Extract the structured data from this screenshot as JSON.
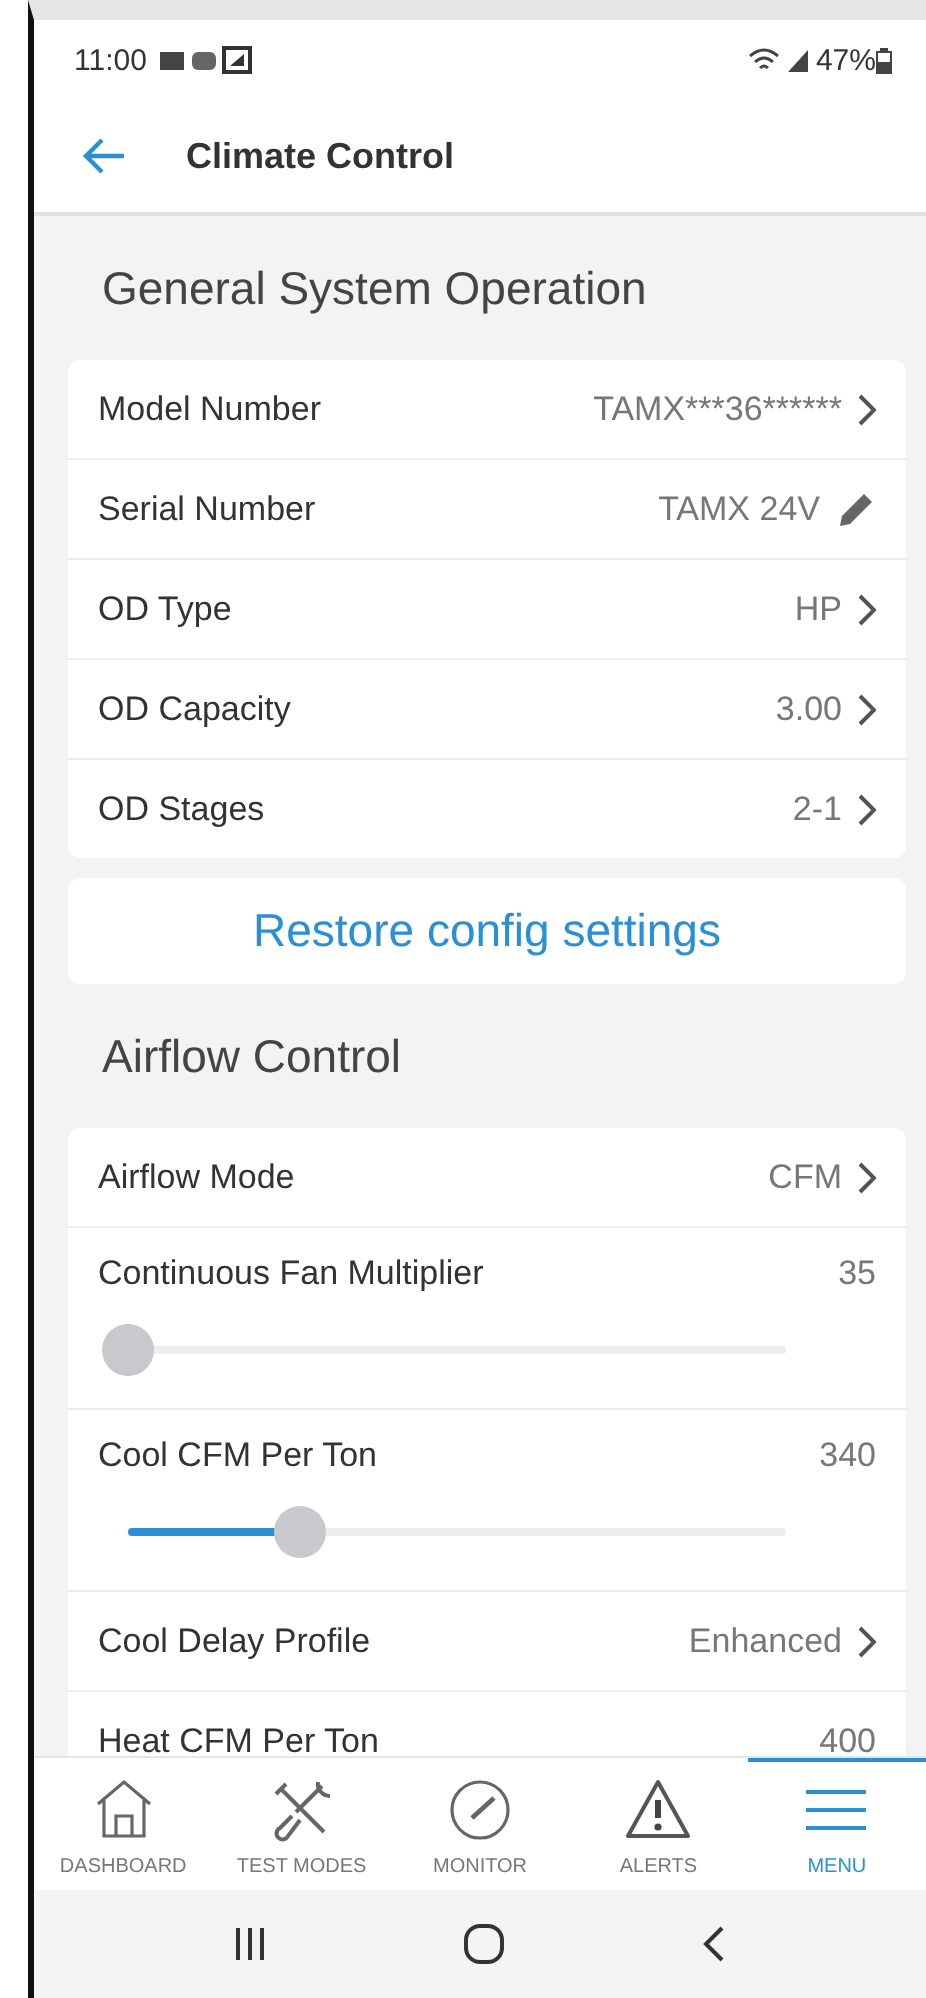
{
  "status_bar": {
    "time": "11:00",
    "battery": "47%"
  },
  "header": {
    "title": "Climate Control"
  },
  "sections": [
    {
      "title": "General System Operation",
      "rows": [
        {
          "kind": "link",
          "label": "Model Number",
          "value": "TAMX***36******"
        },
        {
          "kind": "edit",
          "label": "Serial Number",
          "value": "TAMX 24V"
        },
        {
          "kind": "link",
          "label": "OD Type",
          "value": "HP"
        },
        {
          "kind": "link",
          "label": "OD Capacity",
          "value": "3.00"
        },
        {
          "kind": "link",
          "label": "OD Stages",
          "value": "2-1"
        }
      ],
      "action": "Restore config settings"
    },
    {
      "title": "Airflow Control",
      "rows": [
        {
          "kind": "link",
          "label": "Airflow Mode",
          "value": "CFM"
        },
        {
          "kind": "slider",
          "label": "Continuous Fan Multiplier",
          "value": "35",
          "level": 0
        },
        {
          "kind": "slider",
          "label": "Cool CFM Per Ton",
          "value": "340",
          "level": 0.26
        },
        {
          "kind": "link",
          "label": "Cool Delay Profile",
          "value": "Enhanced"
        },
        {
          "kind": "plain",
          "label": "Heat CFM Per Ton",
          "value": "400"
        }
      ]
    }
  ],
  "nav": [
    {
      "kind": "home",
      "label": "DASHBOARD",
      "selected": false
    },
    {
      "kind": "tools",
      "label": "TEST MODES",
      "selected": false
    },
    {
      "kind": "gauge",
      "label": "MONITOR",
      "selected": false
    },
    {
      "kind": "alert",
      "label": "ALERTS",
      "selected": false
    },
    {
      "kind": "menu",
      "label": "MENU",
      "selected": true
    }
  ]
}
